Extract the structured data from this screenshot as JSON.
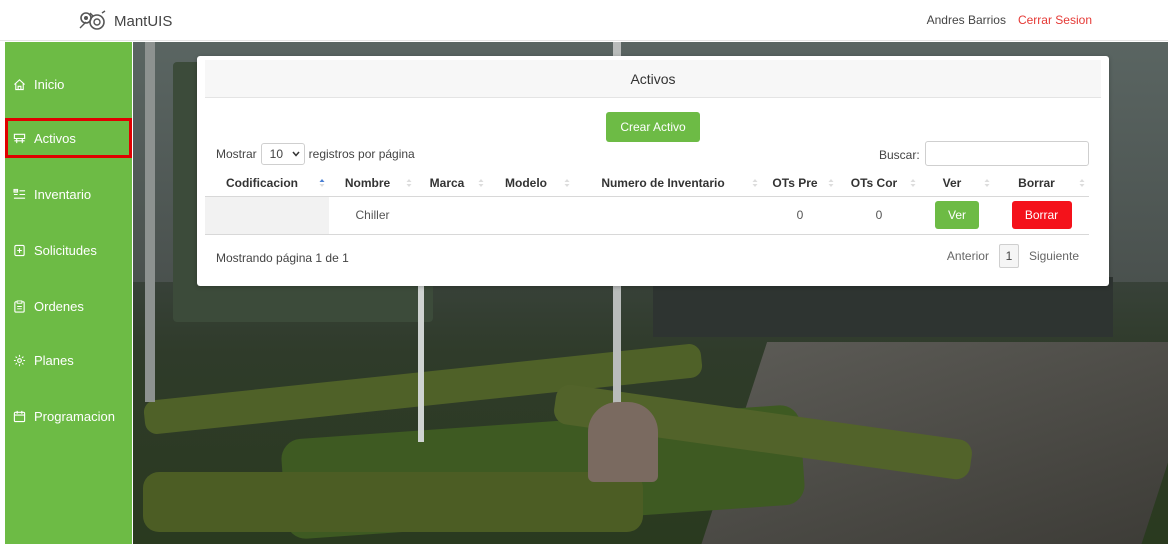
{
  "header": {
    "brand": "MantUIS",
    "user_name": "Andres Barrios",
    "logout_label": "Cerrar Sesion"
  },
  "sidebar": {
    "items": [
      {
        "label": "Inicio",
        "icon": "home-icon"
      },
      {
        "label": "Activos",
        "icon": "activos-icon",
        "active": true
      },
      {
        "label": "Inventario",
        "icon": "inventory-icon"
      },
      {
        "label": "Solicitudes",
        "icon": "request-icon"
      },
      {
        "label": "Ordenes",
        "icon": "clipboard-icon"
      },
      {
        "label": "Planes",
        "icon": "gear-icon"
      },
      {
        "label": "Programacion",
        "icon": "calendar-icon"
      }
    ]
  },
  "panel": {
    "title": "Activos",
    "create_button": "Crear Activo",
    "length_prefix": "Mostrar",
    "length_value": "10",
    "length_suffix": "registros por página",
    "search_label": "Buscar:",
    "search_value": "",
    "columns": [
      "Codificacion",
      "Nombre",
      "Marca",
      "Modelo",
      "Numero de Inventario",
      "OTs Pre",
      "OTs Cor",
      "Ver",
      "Borrar"
    ],
    "rows": [
      {
        "codificacion": "",
        "nombre": "Chiller",
        "marca": "",
        "modelo": "",
        "inventario": "",
        "ots_pre": "0",
        "ots_cor": "0",
        "ver": "Ver",
        "borrar": "Borrar"
      }
    ],
    "info": "Mostrando página 1 de 1",
    "pager": {
      "prev": "Anterior",
      "current": "1",
      "next": "Siguiente"
    }
  },
  "colors": {
    "accent_green": "#6dbb45",
    "danger_red": "#f4121b",
    "logout_red": "#e53935",
    "highlight_red": "#e00000"
  }
}
